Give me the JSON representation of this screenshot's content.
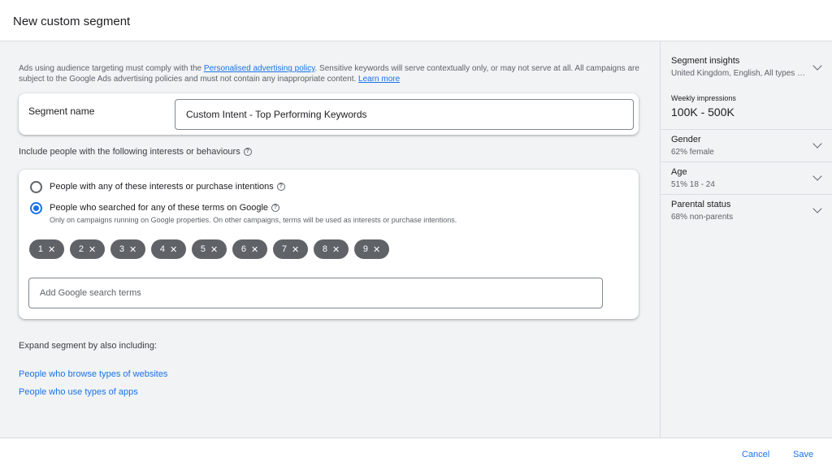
{
  "header": {
    "title": "New custom segment"
  },
  "notice": {
    "text_before": "Ads using audience targeting must comply with the ",
    "policy_link": "Personalised advertising policy",
    "text_after": ". Sensitive keywords will serve contextually only, or may not serve at all. All campaigns are subject to the Google Ads advertising policies and must not contain any inappropriate content. ",
    "learn_more": "Learn more"
  },
  "segment_name": {
    "label": "Segment name",
    "value": "Custom Intent - Top Performing Keywords"
  },
  "include": {
    "label": "Include people with the following interests or behaviours",
    "option_interests": "People with any of these interests or purchase intentions",
    "option_searched": "People who searched for any of these terms on Google",
    "option_searched_note": "Only on campaigns running on Google properties. On other campaigns, terms will be used as interests or purchase intentions.",
    "selected": "searched",
    "terms": [
      "1",
      "2",
      "3",
      "4",
      "5",
      "6",
      "7",
      "8",
      "9"
    ],
    "search_placeholder": "Add Google search terms"
  },
  "expand": {
    "label": "Expand segment by also including:",
    "websites_link": "People who browse types of websites",
    "apps_link": "People who use types of apps"
  },
  "insights": {
    "title": "Segment insights",
    "summary": "United Kingdom, English, All types of devices",
    "weekly_impressions_label": "Weekly impressions",
    "weekly_impressions_value": "100K - 500K",
    "gender_label": "Gender",
    "gender_value": "62% female",
    "age_label": "Age",
    "age_value": "51% 18 - 24",
    "parental_label": "Parental status",
    "parental_value": "68% non-parents"
  },
  "footer": {
    "cancel": "Cancel",
    "save": "Save"
  },
  "colors": {
    "accent": "#1a73e8",
    "chip": "#5f6368",
    "panel_bg": "#f1f3f4"
  },
  "icons": {
    "help": "help-circle-icon",
    "chevron": "chevron-down-icon",
    "chip_remove": "close-icon"
  }
}
